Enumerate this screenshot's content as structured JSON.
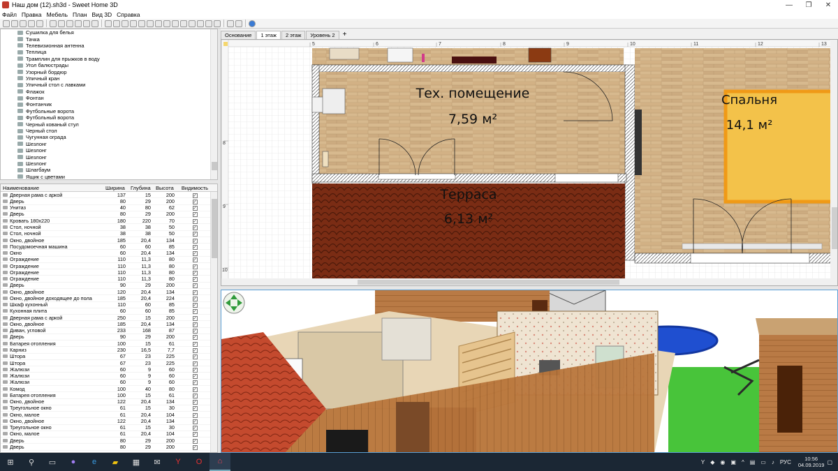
{
  "window": {
    "title": "Наш дом (12).sh3d - Sweet Home 3D",
    "controls": [
      "—",
      "❐",
      "✕"
    ]
  },
  "menu": [
    "Файл",
    "Правка",
    "Мебель",
    "План",
    "Вид 3D",
    "Справка"
  ],
  "catalog": {
    "items": [
      "Сушилка для белья",
      "Тачка",
      "Телевизионная антенна",
      "Теплица",
      "Трамплин для прыжков в воду",
      "Угол балюстрады",
      "Узорный бордюр",
      "Уличный кран",
      "Уличный стол с лавками",
      "Флажок",
      "Фонтан",
      "Фонтанчик",
      "Футбольные ворота",
      "Футбольный ворота",
      "Черный кованый стул",
      "Черный стол",
      "Чугунная ограда",
      "Шезлонг",
      "Шезлонг",
      "Шезлонг",
      "Шезлонг",
      "Шлагбаум",
      "Ящик с цветами"
    ]
  },
  "furniture": {
    "columns": [
      "Наименование",
      "Ширина",
      "Глубина",
      "Высота",
      "Видимость"
    ],
    "rows": [
      [
        "Дверная рама с аркой",
        "137",
        "15",
        "200"
      ],
      [
        "Дверь",
        "80",
        "29",
        "200"
      ],
      [
        "Унитаз",
        "40",
        "80",
        "62"
      ],
      [
        "Дверь",
        "80",
        "29",
        "200"
      ],
      [
        "Кровать 180x220",
        "180",
        "220",
        "70"
      ],
      [
        "Стол, ночной",
        "38",
        "38",
        "50"
      ],
      [
        "Стол, ночной",
        "38",
        "38",
        "50"
      ],
      [
        "Окно, двойное",
        "185",
        "20,4",
        "134"
      ],
      [
        "Посудомоечная машина",
        "60",
        "60",
        "85"
      ],
      [
        "Окно",
        "60",
        "20,4",
        "134"
      ],
      [
        "Ограждение",
        "110",
        "11,3",
        "80"
      ],
      [
        "Ограждение",
        "110",
        "11,3",
        "80"
      ],
      [
        "Ограждение",
        "110",
        "11,3",
        "80"
      ],
      [
        "Ограждение",
        "110",
        "11,3",
        "80"
      ],
      [
        "Дверь",
        "90",
        "29",
        "200"
      ],
      [
        "Окно, двойное",
        "120",
        "20,4",
        "134"
      ],
      [
        "Окно, двойное доходящее до пола",
        "185",
        "20,4",
        "224"
      ],
      [
        "Шкаф кухонный",
        "110",
        "60",
        "85"
      ],
      [
        "Кухонная плита",
        "60",
        "60",
        "85"
      ],
      [
        "Дверная рама с аркой",
        "250",
        "15",
        "200"
      ],
      [
        "Окно, двойное",
        "185",
        "20,4",
        "134"
      ],
      [
        "Диван, угловой",
        "233",
        "168",
        "87"
      ],
      [
        "Дверь",
        "90",
        "29",
        "200"
      ],
      [
        "Батарея отопления",
        "100",
        "15",
        "61"
      ],
      [
        "Карниз",
        "230",
        "16,5",
        "7,7"
      ],
      [
        "Штора",
        "67",
        "23",
        "225"
      ],
      [
        "Штора",
        "67",
        "23",
        "225"
      ],
      [
        "Жалюзи",
        "60",
        "9",
        "60"
      ],
      [
        "Жалюзи",
        "60",
        "9",
        "60"
      ],
      [
        "Жалюзи",
        "60",
        "9",
        "60"
      ],
      [
        "Комод",
        "100",
        "40",
        "80"
      ],
      [
        "Батарея отопления",
        "100",
        "15",
        "61"
      ],
      [
        "Окно, двойное",
        "122",
        "20,4",
        "134"
      ],
      [
        "Треугольное окно",
        "61",
        "15",
        "30"
      ],
      [
        "Окно, малое",
        "61",
        "20,4",
        "104"
      ],
      [
        "Окно, двойное",
        "122",
        "20,4",
        "134"
      ],
      [
        "Треугольное окно",
        "61",
        "15",
        "30"
      ],
      [
        "Окно, малое",
        "61",
        "20,4",
        "104"
      ],
      [
        "Дверь",
        "80",
        "29",
        "200"
      ],
      [
        "Дверь",
        "80",
        "29",
        "200"
      ]
    ]
  },
  "levels": {
    "tabs": [
      "Основание",
      "1 этаж",
      "2 этаж",
      "Уровень 2"
    ],
    "active": "1 этаж",
    "add_label": "+"
  },
  "plan": {
    "ruler_x": [
      "5",
      "6",
      "7",
      "8",
      "9",
      "10",
      "11",
      "12",
      "13"
    ],
    "ruler_y": [
      "8",
      "9",
      "10"
    ],
    "rooms": [
      {
        "name": "Тех. помещение",
        "area": "7,59 м²"
      },
      {
        "name": "Спальня",
        "area": "14,1 м²"
      },
      {
        "name": "Терраса",
        "area": "6,13 м²"
      }
    ],
    "colors": {
      "floor_wood": "#d7b98e",
      "terrace": "#7a2c14",
      "bed": "#f3c24a",
      "bed_border": "#f09a17",
      "grid": "#dcdcdc"
    }
  },
  "taskbar": {
    "icons": [
      "windows-icon",
      "search-icon",
      "task-view-icon",
      "alice-icon",
      "edge-icon",
      "explorer-icon",
      "store-icon",
      "mail-icon",
      "yandex-browser-icon",
      "opera-icon",
      "sweethome3d-icon"
    ],
    "language": "РУС",
    "time": "10:56",
    "date": "04.09.2019"
  }
}
